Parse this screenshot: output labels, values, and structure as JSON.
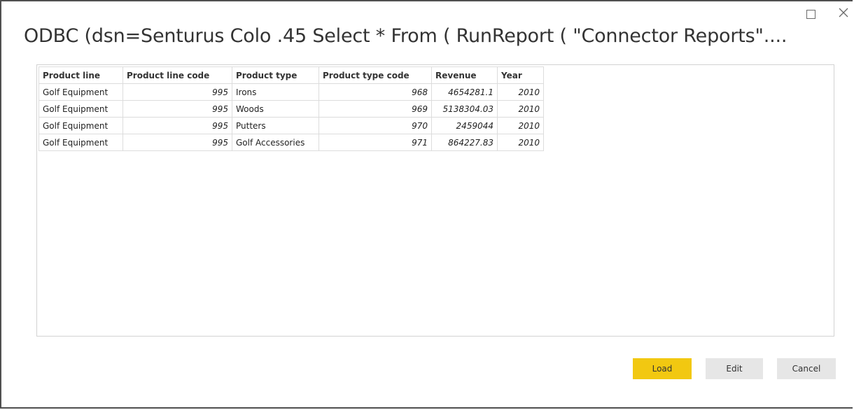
{
  "window": {
    "title": "ODBC (dsn=Senturus Colo .45 Select * From ( RunReport ( \"Connector Reports\"....",
    "maximize_icon": "maximize-icon",
    "close_icon": "close-icon"
  },
  "table": {
    "columns": [
      "Product line",
      "Product line code",
      "Product type",
      "Product type code",
      "Revenue",
      "Year"
    ],
    "rows": [
      [
        "Golf Equipment",
        "995",
        "Irons",
        "968",
        "4654281.1",
        "2010"
      ],
      [
        "Golf Equipment",
        "995",
        "Woods",
        "969",
        "5138304.03",
        "2010"
      ],
      [
        "Golf Equipment",
        "995",
        "Putters",
        "970",
        "2459044",
        "2010"
      ],
      [
        "Golf Equipment",
        "995",
        "Golf Accessories",
        "971",
        "864227.83",
        "2010"
      ]
    ]
  },
  "buttons": {
    "load_label": "Load",
    "edit_label": "Edit",
    "cancel_label": "Cancel"
  },
  "colors": {
    "accent": "#f2c811",
    "secondary_button": "#e6e6e6",
    "grid_border": "#dcdcdc"
  }
}
